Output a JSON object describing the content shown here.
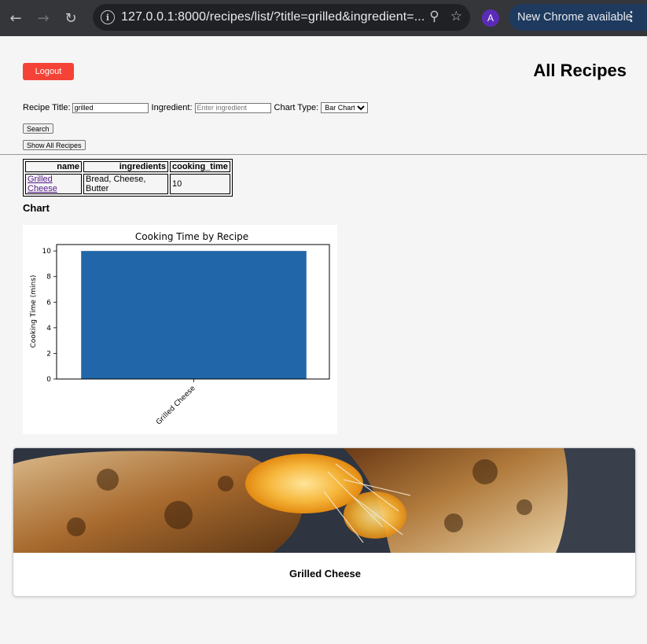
{
  "browser": {
    "url": "127.0.0.1:8000/recipes/list/?title=grilled&ingredient=...",
    "profile_initial": "A",
    "update_label": "New Chrome available",
    "icons": [
      "back-arrow-icon",
      "forward-arrow-icon",
      "reload-icon",
      "site-info-icon",
      "zoom-icon",
      "bookmark-star-icon",
      "more-vert-icon"
    ]
  },
  "page": {
    "logout_label": "Logout",
    "title": "All Recipes"
  },
  "search": {
    "title_label": "Recipe Title:",
    "title_value": "grilled",
    "ingredient_label": "Ingredient:",
    "ingredient_placeholder": "Enter ingredient",
    "chart_type_label": "Chart Type:",
    "chart_type_selected": "Bar Chart",
    "search_label": "Search",
    "show_all_label": "Show All Recipes"
  },
  "table": {
    "headers": [
      "name",
      "ingredients",
      "cooking_time"
    ],
    "rows": [
      {
        "name": "Grilled Cheese",
        "ingredients": "Bread, Cheese, Butter",
        "cooking_time": "10"
      }
    ]
  },
  "chart_heading": "Chart",
  "chart_data": {
    "type": "bar",
    "title": "Cooking Time by Recipe",
    "xlabel": "",
    "ylabel": "Cooking Time (mins)",
    "categories": [
      "Grilled Cheese"
    ],
    "values": [
      10
    ],
    "ylim": [
      0,
      10.5
    ],
    "yticks": [
      0,
      2,
      4,
      6,
      8,
      10
    ],
    "bar_color": "#2166a8",
    "grid": false
  },
  "cards": [
    {
      "title": "Grilled Cheese"
    }
  ]
}
